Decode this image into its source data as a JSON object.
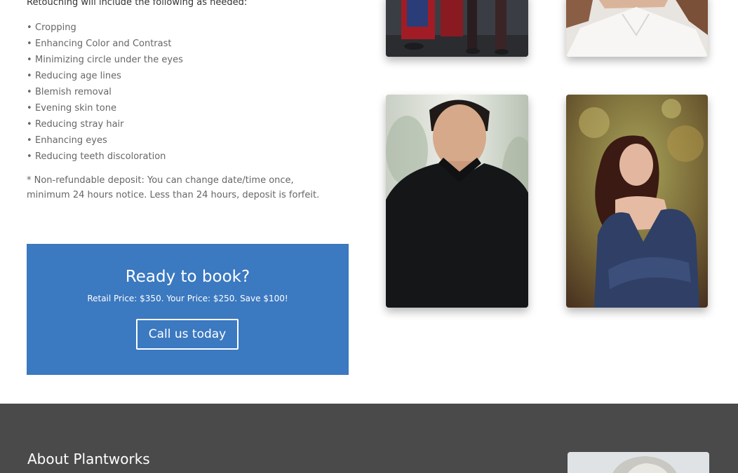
{
  "content": {
    "intro": "Retouching will include the following as needed:",
    "retouch_items": [
      "Cropping",
      "Enhancing Color and Contrast",
      "Minimizing circle under the eyes",
      "Reducing age lines",
      "Blemish removal",
      "Evening skin tone",
      "Reducing stray hair",
      "Enhancing eyes",
      "Reducing teeth discoloration"
    ],
    "deposit_note": "* Non-refundable deposit: You can change date/time once, minimum 24 hours notice.  Less than 24 hours, deposit is forfeit."
  },
  "cta": {
    "title": "Ready to book?",
    "price_text": "Retail Price: $350.  Your Price: $250.  Save $100!",
    "button_label": "Call us today",
    "background_color": "#3b79c0"
  },
  "gallery": {
    "photos": [
      {
        "name": "photo-costume-group"
      },
      {
        "name": "photo-woman-white-shirt"
      },
      {
        "name": "photo-man-black-sweater"
      },
      {
        "name": "photo-woman-blue-dress"
      }
    ]
  },
  "footer": {
    "heading": "About Plantworks",
    "background_color": "#4a4a4a",
    "photo": "photo-gray-haired-woman"
  }
}
